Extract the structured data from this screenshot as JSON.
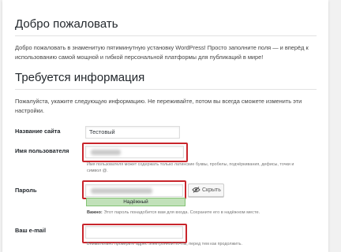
{
  "welcome": {
    "title": "Добро пожаловать",
    "intro": "Добро пожаловать в знаменитую пятиминутную установку WordPress! Просто заполните поля — и вперёд к использованию самой мощной и гибкой персональной платформы для публикаций в мире!"
  },
  "info": {
    "title": "Требуется информация",
    "intro": "Пожалуйста, укажите следующую информацию. Не переживайте, потом вы всегда сможете изменить эти настройки."
  },
  "form": {
    "site_title": {
      "label": "Название сайта",
      "value": "Тестовый"
    },
    "username": {
      "label": "Имя пользователя",
      "description": "Имя пользователя может содержать только латинские буквы, пробелы, подчёркивания, дефисы, точки и символ @."
    },
    "password": {
      "label": "Пароль",
      "hide_button": "Скрыть",
      "strength": "Надёжный",
      "important_label": "Важно:",
      "important_text": "Этот пароль понадобится вам для входа. Сохраните его в надёжном месте."
    },
    "email": {
      "label": "Ваш e-mail",
      "description": "Внимательно проверьте адрес электронной почты, перед тем как продолжить."
    }
  },
  "colors": {
    "highlight": "#c8252c",
    "strength_bg": "#c1e1b9"
  }
}
